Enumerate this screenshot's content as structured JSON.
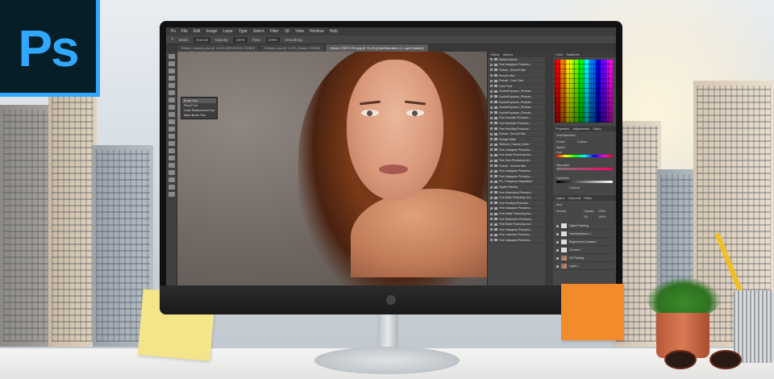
{
  "logo": {
    "text": "Ps",
    "color": "#31a8ff"
  },
  "menu": [
    "Ps",
    "File",
    "Edit",
    "Image",
    "Layer",
    "Type",
    "Select",
    "Filter",
    "3D",
    "View",
    "Window",
    "Help"
  ],
  "options": {
    "mode_label": "Mode:",
    "mode_value": "Normal",
    "opacity_label": "Opacity:",
    "opacity_value": "100%",
    "flow_label": "Flow:",
    "flow_value": "100%",
    "smoothing_label": "Smoothing:"
  },
  "tabs": [
    {
      "label": "Edition_mockup.psd @ 14.6% (BRUSHES, RGB/8)"
    },
    {
      "label": "Edition1.psd @ 13.3% (Shape, RGB/8)"
    },
    {
      "label": "iStock-178071794.jpg @ 74.4% (Hue/Saturation 1, Layer Mask/8)",
      "active": true
    }
  ],
  "popup": [
    "Brush Tool",
    "Pencil Tool",
    "Color Replacement Tool",
    "Mixer Brush Tool"
  ],
  "actions_panel": {
    "tabs": [
      "History",
      "Actions"
    ],
    "rows": [
      "Default Actions",
      "Fine Instagram Photosho...",
      "Portrait - Smooth Skin",
      "Smooth Skin",
      "Portrait - Color Tone",
      "Color Tone",
      "DoubleExposure_Photosh...",
      "DoubleExposure_Photosh...",
      "DoubleExposure_Photosh...",
      "DoubleExposure_Photosh...",
      "DoubleExposure_Photosh...",
      "Fine Dramatic Photosho...",
      "Free Dramatic Photosho...",
      "Free Wedding Photosho...",
      "Portrait - Smooth Skin",
      "Vintage Matte",
      "Retouch_Channel_Mixer",
      "Free Instagram Photosho...",
      "Free Black Photoshop Act...",
      "Free Dust Photoshop Act...",
      "Portrait - Smooth Skin",
      "Free Instagram Photosho...",
      "Free Instagram Photosho...",
      "PS - Frequency Separation",
      "Digital Painting",
      "Free Watercolor Photosho...",
      "Fine Matte Photoshop Act...",
      "Free Painting Photosho...",
      "Free Instagram Photosho...",
      "Free Matte Photoshop Act...",
      "Free Watercolor Photosho...",
      "Free Black Photoshop Act...",
      "Free Instagram Photosho...",
      "Fine Collection Photosho...",
      "Free Instagram Photosho..."
    ]
  },
  "right_panel": {
    "top_tabs": [
      "Color",
      "Swatches"
    ],
    "props_tabs": [
      "Properties",
      "Adjustments",
      "Styles"
    ],
    "hue_label": "Hue/Saturation",
    "preset_label": "Preset:",
    "preset_value": "Custom",
    "master_value": "Master",
    "hue": "Hue:",
    "saturation": "Saturation:",
    "lightness": "Lightness:",
    "colorize": "Colorize",
    "layers_tabs": [
      "Layers",
      "Channels",
      "Paths"
    ],
    "kind_label": "Kind",
    "blend_value": "Normal",
    "opacity_label": "Opacity:",
    "opacity_value": "100%",
    "fill_label": "Fill:",
    "fill_value": "100%",
    "layers": [
      "Digital Painting",
      "Hue/Saturation 1",
      "Brightness/Contrast 1",
      "Curves 1",
      "Oil Painting",
      "Layer 1"
    ]
  }
}
